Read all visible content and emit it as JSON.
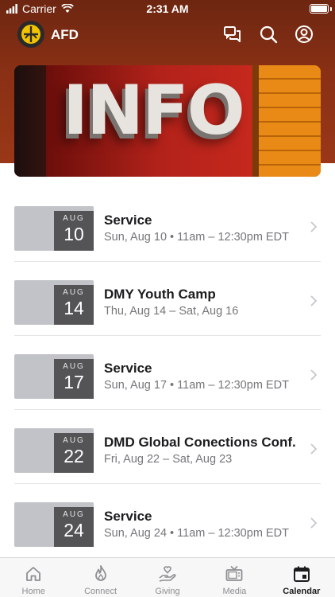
{
  "status_bar": {
    "carrier": "Carrier",
    "time": "2:31 AM"
  },
  "header": {
    "title": "AFD"
  },
  "hero": {
    "text": "INFO"
  },
  "events": [
    {
      "month": "AUG",
      "day": "10",
      "title": "Service",
      "subtitle": "Sun, Aug 10 • 11am – 12:30pm EDT"
    },
    {
      "month": "AUG",
      "day": "14",
      "title": "DMY Youth Camp",
      "subtitle": "Thu, Aug 14 – Sat, Aug 16"
    },
    {
      "month": "AUG",
      "day": "17",
      "title": "Service",
      "subtitle": "Sun, Aug 17 • 11am – 12:30pm EDT"
    },
    {
      "month": "AUG",
      "day": "22",
      "title": "DMD Global Conections Conf.",
      "subtitle": "Fri, Aug 22 – Sat, Aug 23"
    },
    {
      "month": "AUG",
      "day": "24",
      "title": "Service",
      "subtitle": "Sun, Aug 24 • 11am – 12:30pm EDT"
    }
  ],
  "tabs": [
    {
      "label": "Home",
      "icon": "home-icon"
    },
    {
      "label": "Connect",
      "icon": "flame-icon"
    },
    {
      "label": "Giving",
      "icon": "giving-hand-icon"
    },
    {
      "label": "Media",
      "icon": "tv-icon"
    },
    {
      "label": "Calendar",
      "icon": "calendar-icon"
    }
  ],
  "active_tab": "Calendar",
  "colors": {
    "header": "#8a3015",
    "accent_logo": "#f2c300",
    "date_tile": "#545456"
  }
}
